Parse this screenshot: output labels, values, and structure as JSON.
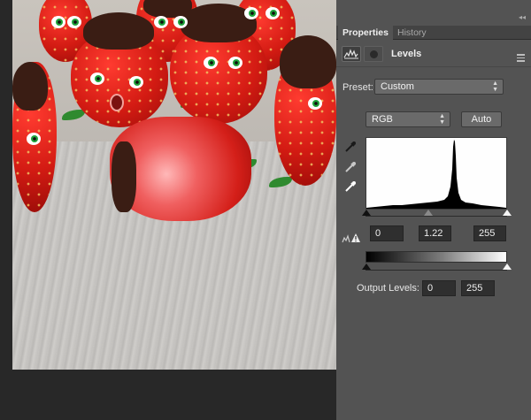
{
  "tabs": [
    {
      "label": "Properties",
      "active": true
    },
    {
      "label": "History",
      "active": false
    }
  ],
  "panel": {
    "title": "Levels",
    "adjustment_icon": "levels-adjustment-icon",
    "mask_icon": "layer-mask-icon"
  },
  "preset": {
    "label": "Preset:",
    "value": "Custom"
  },
  "channel": {
    "value": "RGB"
  },
  "auto_button": "Auto",
  "eyedroppers": [
    "black-point-eyedropper-icon",
    "gray-point-eyedropper-icon",
    "white-point-eyedropper-icon"
  ],
  "input_levels": {
    "black": "0",
    "gamma": "1.22",
    "white": "255"
  },
  "output_levels": {
    "label": "Output Levels:",
    "black": "0",
    "white": "255"
  },
  "colors": {
    "panel_bg": "#535353",
    "field_bg": "#2f2f2f",
    "dropdown_bg": "#6a6a6a"
  }
}
